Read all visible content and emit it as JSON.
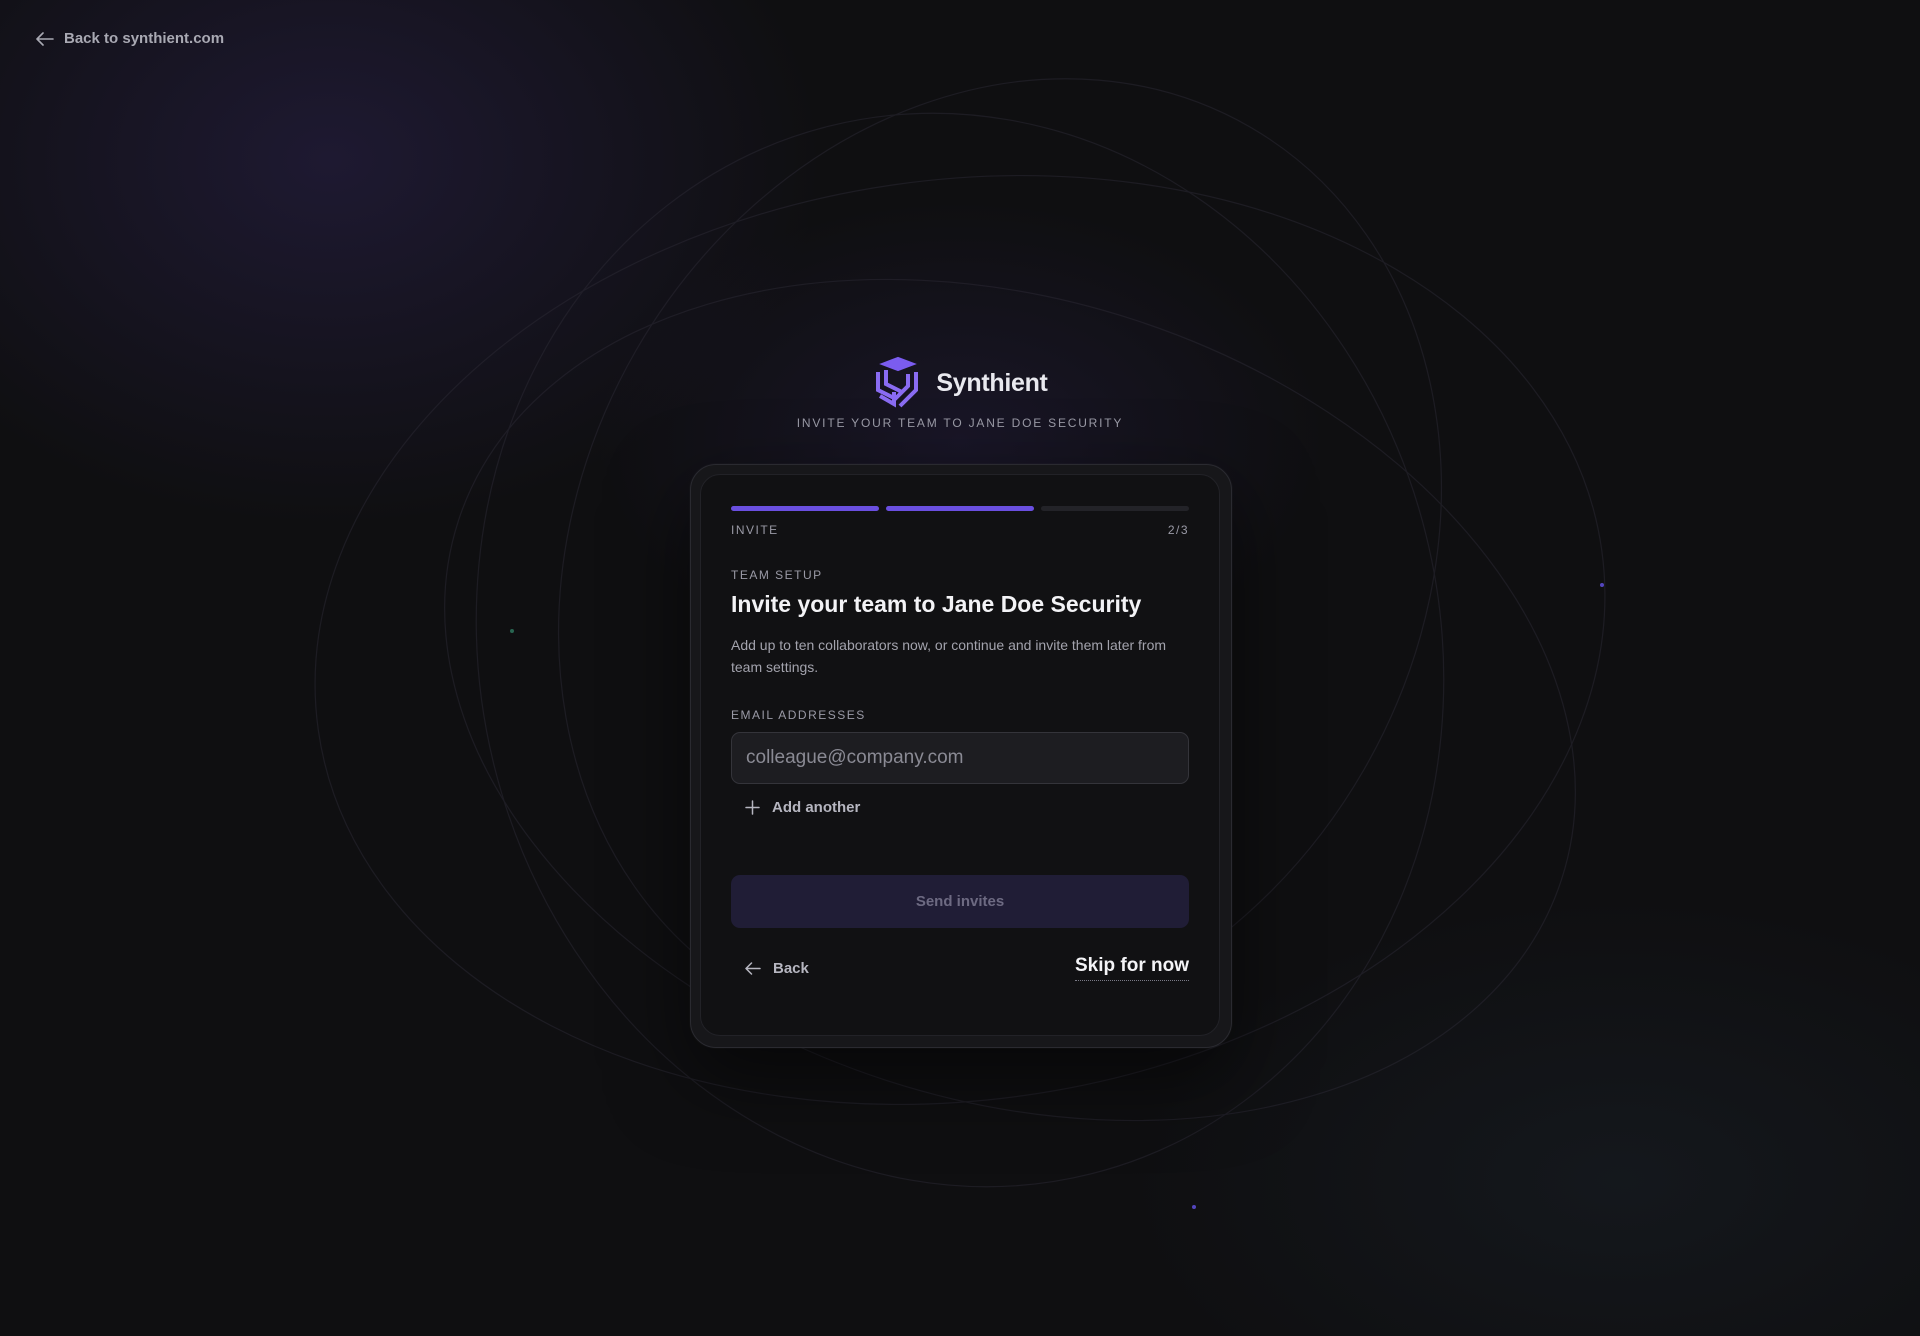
{
  "top_nav": {
    "back_label": "Back to synthient.com"
  },
  "brand": {
    "name": "Synthient",
    "subtitle": "INVITE YOUR TEAM TO JANE DOE SECURITY",
    "logo_icon": "synthient-cube-logo",
    "accent": "#7b5cf0"
  },
  "progress": {
    "current_step": 2,
    "total_steps": 3,
    "step_label": "INVITE",
    "step_counter": "2/3"
  },
  "content": {
    "eyebrow": "TEAM SETUP",
    "title": "Invite your team to Jane Doe Security",
    "description": "Add up to ten collaborators now, or continue and invite them later from team settings."
  },
  "form": {
    "email_label": "EMAIL ADDRESSES",
    "email_value": "",
    "email_placeholder": "colleague@company.com",
    "add_another_label": "Add another",
    "send_label": "Send invites"
  },
  "footer": {
    "back_label": "Back",
    "skip_label": "Skip for now"
  },
  "colors": {
    "background": "#0f0f11",
    "card": "#111113",
    "progress_active": "#6a4fe0",
    "progress_inactive": "#232328",
    "send_button_disabled": "#201d36"
  }
}
